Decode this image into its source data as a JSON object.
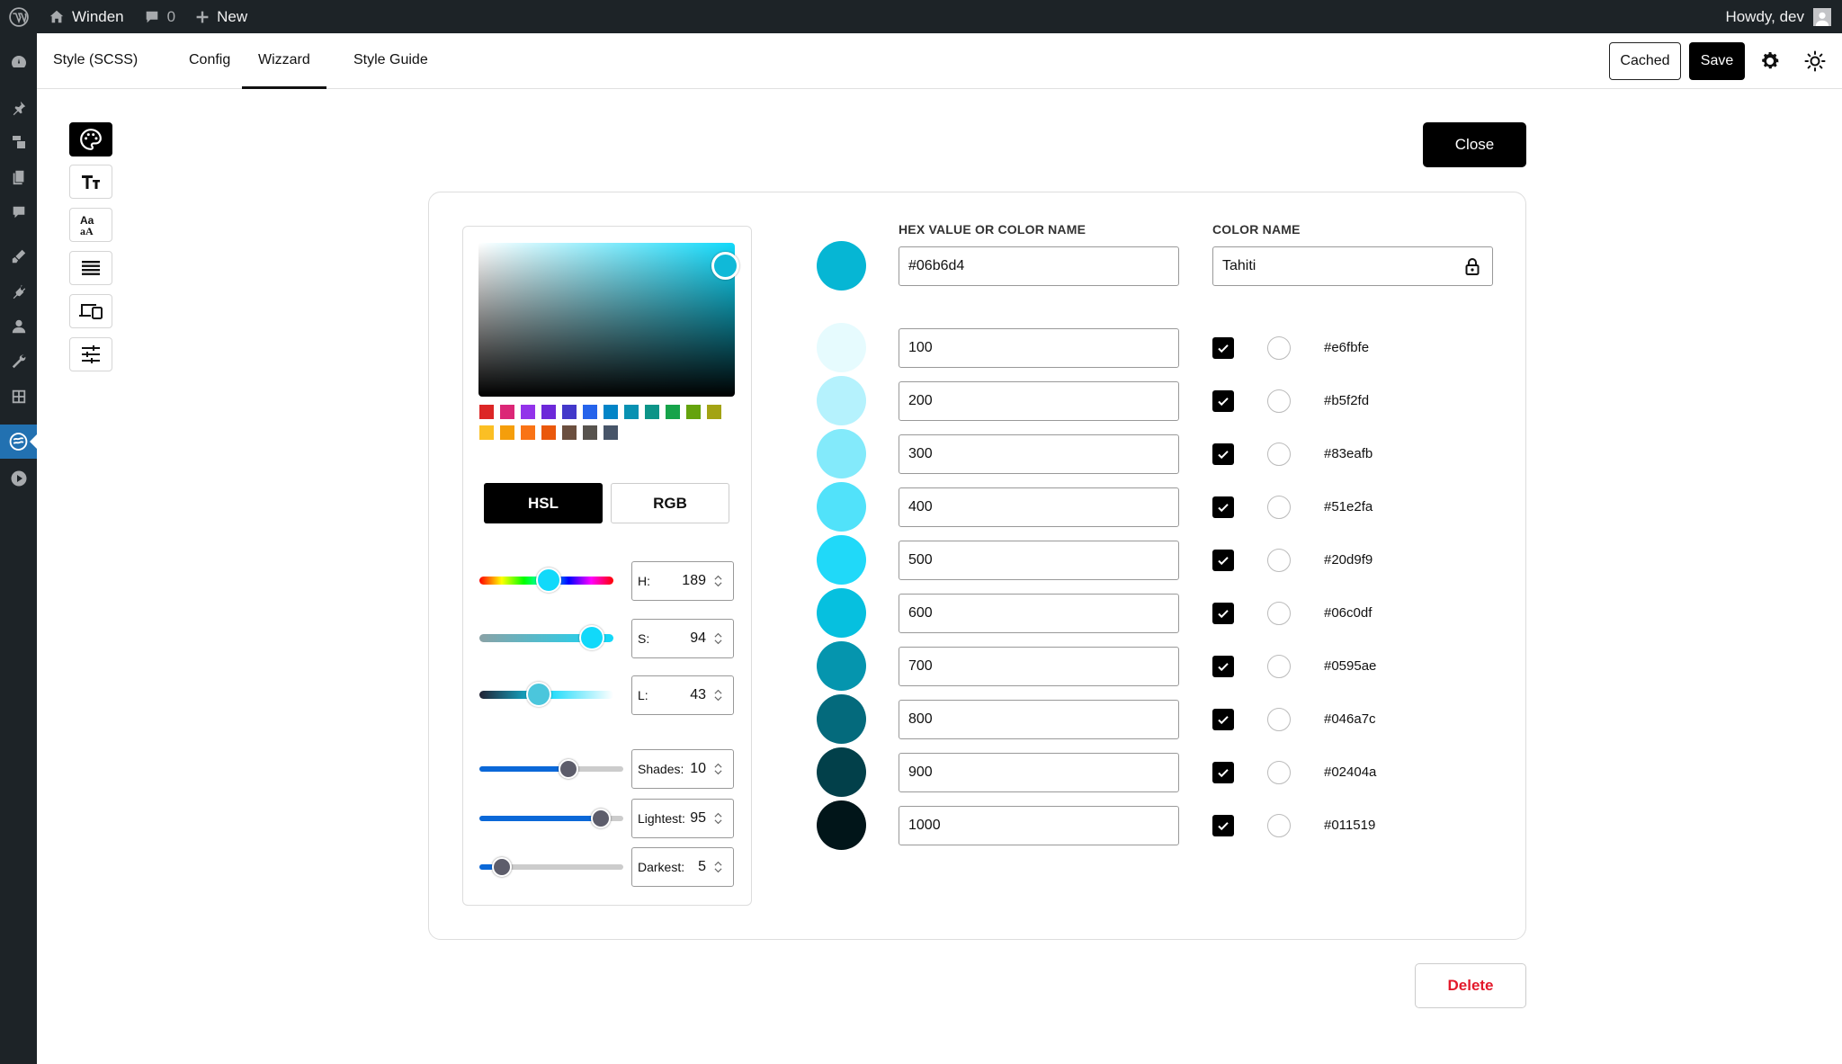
{
  "adminbar": {
    "site_name": "Winden",
    "comments_count": "0",
    "new_label": "New",
    "howdy": "Howdy, dev"
  },
  "tabs": [
    {
      "label": "Style (SCSS)"
    },
    {
      "label": "Config"
    },
    {
      "label": "Wizzard",
      "active": true
    },
    {
      "label": "Style Guide"
    }
  ],
  "toolbar": {
    "cached_label": "Cached",
    "save_label": "Save"
  },
  "close_label": "Close",
  "delete_label": "Delete",
  "picker": {
    "mode_hsl": "HSL",
    "mode_rgb": "RGB",
    "preset_swatches": [
      "#dc2626",
      "#db2777",
      "#9333ea",
      "#6d28d9",
      "#4338ca",
      "#2563eb",
      "#0284c7",
      "#0891b2",
      "#0d9488",
      "#16a34a",
      "#65a30d",
      "#a3a314",
      "#fbbf24",
      "#f59e0b",
      "#f97316",
      "#ea580c",
      "#6b4f3f",
      "#57534e",
      "#475569"
    ],
    "hue": {
      "label": "H:",
      "value": "189"
    },
    "saturation": {
      "label": "S:",
      "value": "94"
    },
    "lightness": {
      "label": "L:",
      "value": "43"
    },
    "shades": {
      "label": "Shades:",
      "value": "10"
    },
    "lightest": {
      "label": "Lightest:",
      "value": "95"
    },
    "darkest": {
      "label": "Darkest:",
      "value": "5"
    }
  },
  "color": {
    "hex_label": "HEX VALUE OR COLOR NAME",
    "hex_value": "#06b6d4",
    "name_label": "COLOR NAME",
    "name_value": "Tahiti",
    "swatch": "#06b6d4"
  },
  "shades": [
    {
      "name": "100",
      "hex": "#e6fbfe",
      "checked": true
    },
    {
      "name": "200",
      "hex": "#b5f2fd",
      "checked": true
    },
    {
      "name": "300",
      "hex": "#83eafb",
      "checked": true
    },
    {
      "name": "400",
      "hex": "#51e2fa",
      "checked": true
    },
    {
      "name": "500",
      "hex": "#20d9f9",
      "checked": true
    },
    {
      "name": "600",
      "hex": "#06c0df",
      "checked": true
    },
    {
      "name": "700",
      "hex": "#0595ae",
      "checked": true
    },
    {
      "name": "800",
      "hex": "#046a7c",
      "checked": true
    },
    {
      "name": "900",
      "hex": "#02404a",
      "checked": true
    },
    {
      "name": "1000",
      "hex": "#011519",
      "checked": true
    }
  ]
}
